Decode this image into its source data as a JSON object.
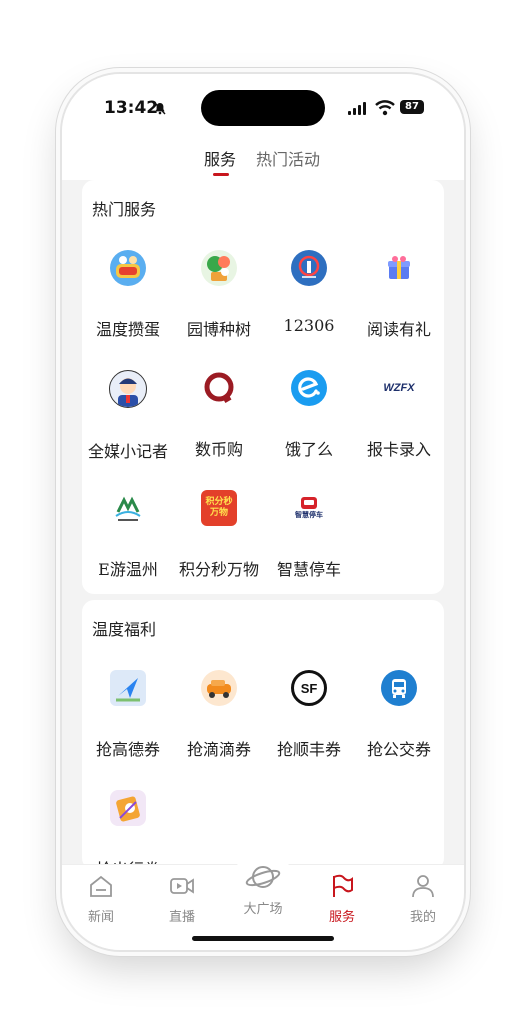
{
  "status": {
    "time": "13:42",
    "battery": "87"
  },
  "tabs": [
    {
      "label": "服务"
    },
    {
      "label": "热门活动"
    }
  ],
  "hot_services": {
    "title": "热门服务",
    "items": [
      {
        "label": "温度攒蛋",
        "icon": "egg-game-icon"
      },
      {
        "label": "园博种树",
        "icon": "tree-planting-icon"
      },
      {
        "label": "12306",
        "icon": "railway-icon"
      },
      {
        "label": "阅读有礼",
        "icon": "gift-box-icon"
      },
      {
        "label": "全媒小记者",
        "icon": "kid-reporter-icon"
      },
      {
        "label": "数币购",
        "icon": "digital-currency-icon"
      },
      {
        "label": "饿了么",
        "icon": "eleme-icon"
      },
      {
        "label": "报卡录入",
        "icon": "wzfx-icon",
        "icon_text": "WZFX"
      },
      {
        "label": "E游温州",
        "icon": "e-tour-icon"
      },
      {
        "label": "积分秒万物",
        "icon": "points-icon",
        "icon_text": "积分秒万物"
      },
      {
        "label": "智慧停车",
        "icon": "smart-parking-icon",
        "icon_text": "智慧停车"
      }
    ]
  },
  "benefits": {
    "title": "温度福利",
    "items": [
      {
        "label": "抢高德券",
        "icon": "amap-icon"
      },
      {
        "label": "抢滴滴券",
        "icon": "didi-icon"
      },
      {
        "label": "抢顺丰券",
        "icon": "sf-express-icon",
        "icon_text": "SF"
      },
      {
        "label": "抢公交券",
        "icon": "bus-icon"
      },
      {
        "label": "抢出行券",
        "icon": "travel-icon"
      }
    ]
  },
  "tabbar": [
    {
      "label": "新闻",
      "icon": "news-icon"
    },
    {
      "label": "直播",
      "icon": "live-icon"
    },
    {
      "label": "大广场",
      "icon": "planet-icon"
    },
    {
      "label": "服务",
      "icon": "service-flag-icon",
      "active": true
    },
    {
      "label": "我的",
      "icon": "profile-icon"
    }
  ],
  "colors": {
    "accent": "#c8161d",
    "background": "#f3f3f3"
  }
}
